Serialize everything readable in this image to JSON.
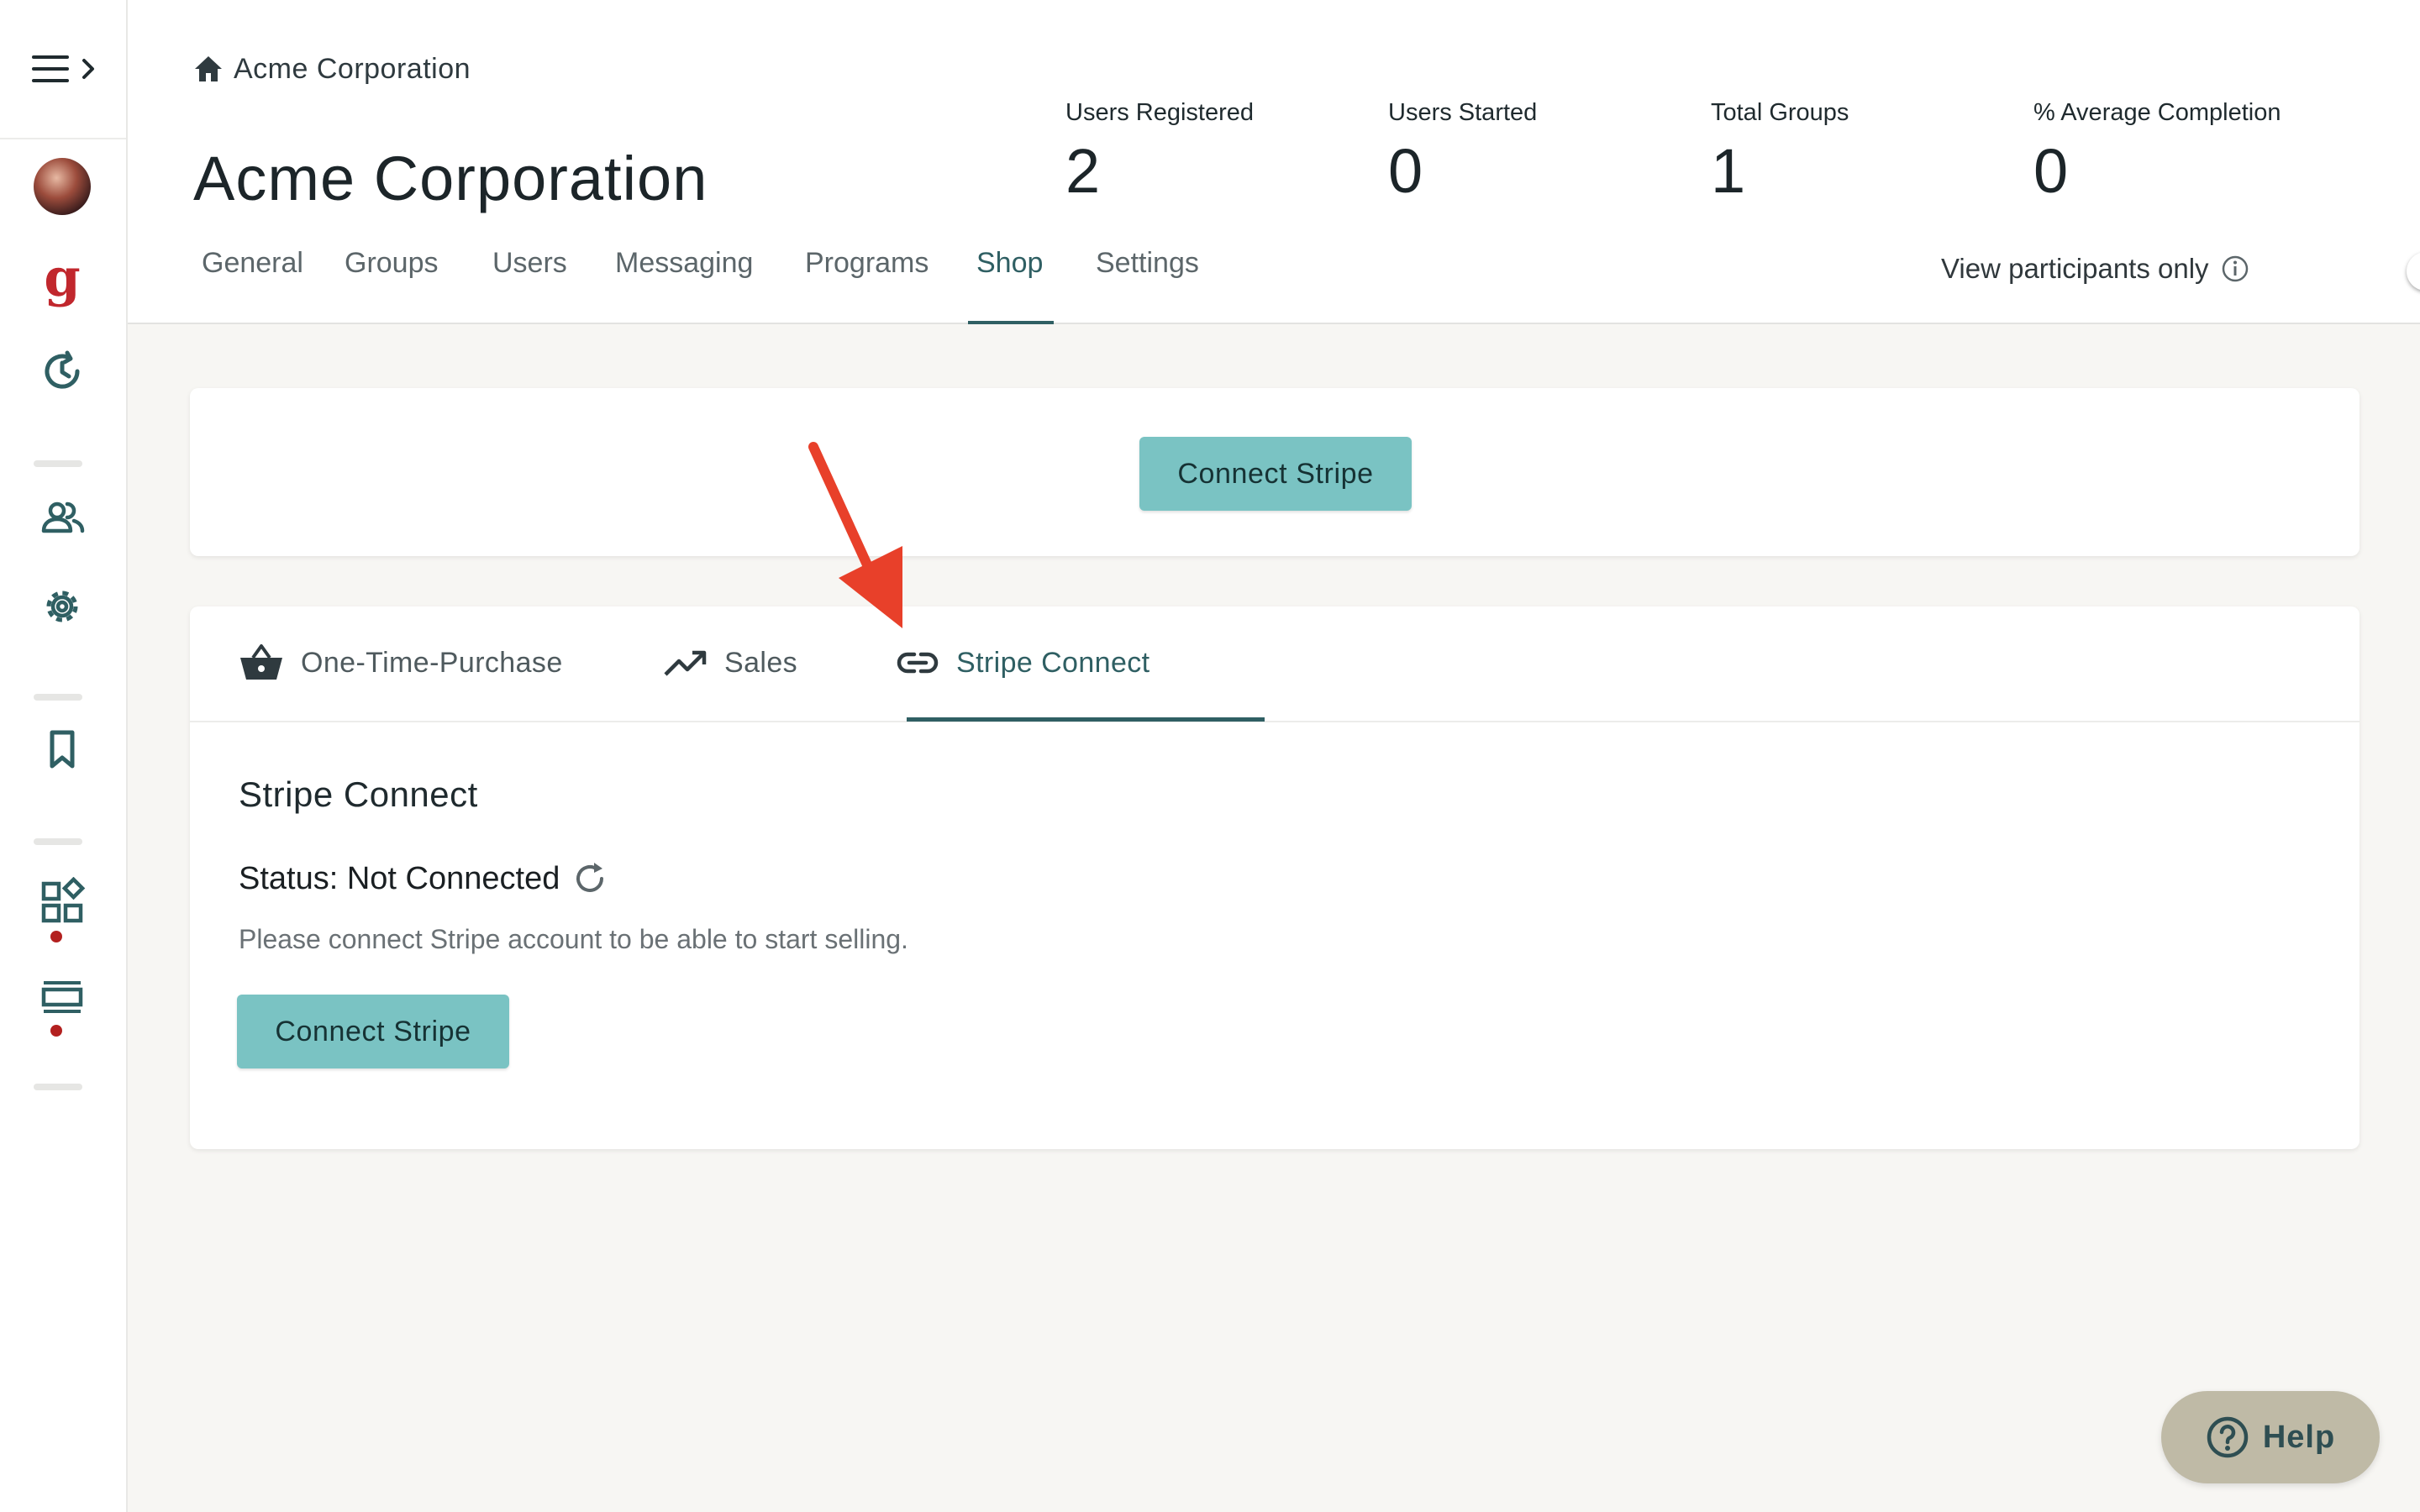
{
  "breadcrumb": {
    "home_icon": "home-icon",
    "label": "Acme Corporation"
  },
  "page": {
    "title": "Acme Corporation"
  },
  "stats": [
    {
      "label": "Users Registered",
      "value": "2"
    },
    {
      "label": "Users Started",
      "value": "0"
    },
    {
      "label": "Total Groups",
      "value": "1"
    },
    {
      "label": "% Average Completion",
      "value": "0"
    }
  ],
  "tabs": [
    {
      "label": "General"
    },
    {
      "label": "Groups"
    },
    {
      "label": "Users"
    },
    {
      "label": "Messaging"
    },
    {
      "label": "Programs"
    },
    {
      "label": "Shop",
      "active": true
    },
    {
      "label": "Settings"
    }
  ],
  "view_participants": {
    "label": "View participants only",
    "enabled": false
  },
  "top_card": {
    "button_label": "Connect Stripe"
  },
  "subtabs": [
    {
      "label": "One-Time-Purchase",
      "icon": "basket-icon"
    },
    {
      "label": "Sales",
      "icon": "trending-up-icon"
    },
    {
      "label": "Stripe Connect",
      "icon": "link-icon",
      "active": true
    }
  ],
  "stripe_connect": {
    "title": "Stripe Connect",
    "status": "Status: Not Connected",
    "description": "Please connect Stripe account to be able to start selling.",
    "button_label": "Connect Stripe"
  },
  "help": {
    "label": "Help"
  },
  "colors": {
    "accent": "#2f5f63",
    "button": "#7ac3c3",
    "brand_red": "#c1272d",
    "annotation_arrow": "#e8402a",
    "help_bg": "#bfbaa6"
  }
}
